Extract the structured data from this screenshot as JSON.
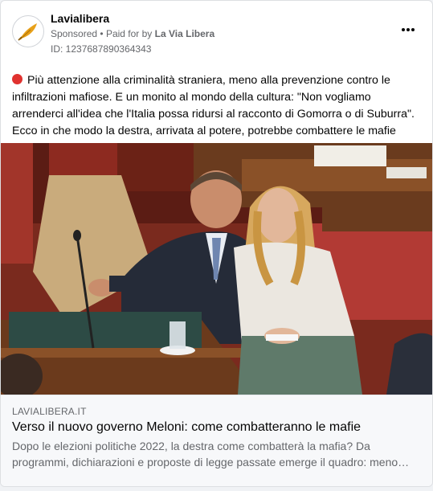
{
  "post": {
    "page_name": "Lavialibera",
    "sponsored_label": "Sponsored",
    "separator": "•",
    "paid_for_prefix": "Paid for by",
    "paid_for_name": "La Via Libera",
    "ad_id": "ID: 1237687890364343",
    "avatar_icon": "quill-feather-icon",
    "more_icon": "more-options-icon",
    "body_text": "Più attenzione alla criminalità straniera, meno alla prevenzione contro le infiltrazioni mafiose. E un monito al mondo della cultura: \"Non vogliamo arrenderci all'idea che l'Italia possa ridursi al racconto di Gomorra o di Suburra\". Ecco in che modo la destra, arrivata al potere, potrebbe combattere le mafie",
    "body_emoji": "red-circle-emoji"
  },
  "link": {
    "domain": "LAVIALIBERA.IT",
    "headline": "Verso il nuovo governo Meloni: come combatteranno le mafie",
    "description": "Dopo le elezioni politiche 2022, la destra come combatterà la mafia? Da programmi, dichiarazioni e proposte di legge passate emerge il quadro: meno…"
  },
  "colors": {
    "accent_red": "#e0322f",
    "logo_gold": "#e8a11a",
    "text_primary": "#050505",
    "text_secondary": "#65676b"
  }
}
